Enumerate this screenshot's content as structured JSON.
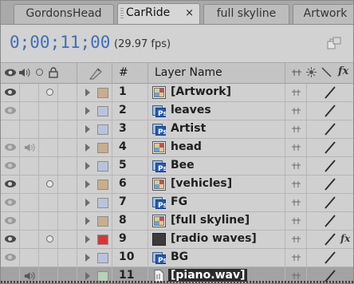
{
  "tabs": [
    {
      "label": "GordonsHead",
      "active": false
    },
    {
      "label": "CarRide",
      "active": true,
      "close": "×"
    },
    {
      "label": "full skyline",
      "active": false
    },
    {
      "label": "Artwork",
      "active": false
    }
  ],
  "timeline": {
    "timecode": "0;00;11;00",
    "fps": "(29.97 fps)"
  },
  "columns": {
    "number": "#",
    "layer_name": "Layer Name",
    "fx": "fx"
  },
  "layers": [
    {
      "num": "1",
      "name": "[Artwork]",
      "type": "precomp",
      "label_color": "#c9ad8c",
      "video": true,
      "audio": false,
      "solo": true,
      "fx": false
    },
    {
      "num": "2",
      "name": "leaves",
      "type": "psd",
      "label_color": "#b9c4dc",
      "video": "dim",
      "audio": false,
      "solo": false,
      "fx": false
    },
    {
      "num": "3",
      "name": "Artist",
      "type": "psd",
      "label_color": "#b9c4dc",
      "video": false,
      "audio": false,
      "solo": false,
      "fx": false
    },
    {
      "num": "4",
      "name": "head",
      "type": "precomp",
      "label_color": "#c9ad8c",
      "video": "dim",
      "audio": "dim",
      "solo": false,
      "fx": false
    },
    {
      "num": "5",
      "name": "Bee",
      "type": "psd",
      "label_color": "#b9c4dc",
      "video": "dim",
      "audio": false,
      "solo": false,
      "fx": false
    },
    {
      "num": "6",
      "name": "[vehicles]",
      "type": "precomp",
      "label_color": "#c9ad8c",
      "video": true,
      "audio": false,
      "solo": true,
      "fx": false
    },
    {
      "num": "7",
      "name": "FG",
      "type": "psd",
      "label_color": "#b9c4dc",
      "video": "dim",
      "audio": false,
      "solo": false,
      "fx": false
    },
    {
      "num": "8",
      "name": "[full skyline]",
      "type": "precomp",
      "label_color": "#c9ad8c",
      "video": "dim",
      "audio": false,
      "solo": false,
      "fx": false
    },
    {
      "num": "9",
      "name": "[radio waves]",
      "type": "solid",
      "label_color": "#d63636",
      "video": true,
      "audio": false,
      "solo": true,
      "fx": true
    },
    {
      "num": "10",
      "name": "BG",
      "type": "psd",
      "label_color": "#b9c4dc",
      "video": "dim",
      "audio": false,
      "solo": false,
      "fx": false
    },
    {
      "num": "11",
      "name": "[piano.wav]",
      "type": "audio",
      "label_color": "#b5d3b5",
      "video": false,
      "audio": true,
      "solo": false,
      "fx": false,
      "selected": true
    }
  ]
}
